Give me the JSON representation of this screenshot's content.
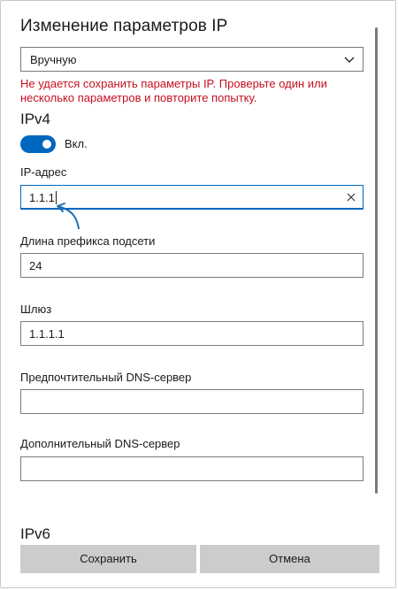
{
  "window": {
    "title": "Изменение параметров IP"
  },
  "mode_select": {
    "value": "Вручную",
    "icon": "chevron-down-icon"
  },
  "error_message": "Не удается сохранить параметры IP. Проверьте один или несколько параметров и повторите попытку.",
  "ipv4": {
    "heading": "IPv4",
    "toggle": {
      "label": "Вкл.",
      "on": true,
      "color": "#0067c0"
    },
    "fields": {
      "ip_address": {
        "label": "IP-адрес",
        "value": "1.1.1"
      },
      "prefix": {
        "label": "Длина префикса подсети",
        "value": "24"
      },
      "gateway": {
        "label": "Шлюз",
        "value": "1.1.1.1"
      },
      "dns_preferred": {
        "label": "Предпочтительный DNS-сервер",
        "value": ""
      },
      "dns_alternate": {
        "label": "Дополнительный DNS-сервер",
        "value": ""
      }
    }
  },
  "ipv6": {
    "heading": "IPv6"
  },
  "buttons": {
    "save": "Сохранить",
    "cancel": "Отмена"
  },
  "colors": {
    "error": "#c50f1f",
    "accent": "#0067c0",
    "button_bg": "#cccccc"
  }
}
